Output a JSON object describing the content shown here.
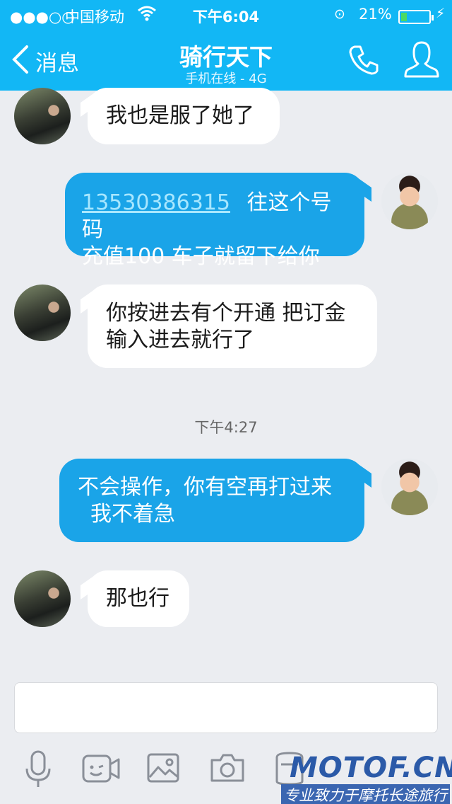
{
  "status_bar": {
    "signal": "●●●○○",
    "carrier": "中国移动",
    "time": "下午6:04",
    "battery_percent": "21%",
    "battery_level": 0.21
  },
  "nav": {
    "back_label": "消息",
    "title": "骑行天下",
    "subtitle": "手机在线 - 4G"
  },
  "messages": [
    {
      "direction": "in",
      "text": "我也是服了她了"
    },
    {
      "direction": "out",
      "phone_link": "13530386315",
      "line1_rest": "往这个号码",
      "line2": "充值100 车子就留下给你"
    },
    {
      "direction": "in",
      "line1": "你按进去有个开通 把订金",
      "line2": "输入进去就行了"
    },
    {
      "direction": "out",
      "line1": "不会操作，你有空再打过来",
      "line2": "我不着急"
    },
    {
      "direction": "in",
      "text": "那也行"
    }
  ],
  "timestamp": "下午4:27",
  "toolbar": [
    "microphone-icon",
    "video-icon",
    "image-icon",
    "camera-icon",
    "file-icon"
  ],
  "watermark": {
    "logo": "MOTOF.CN",
    "tagline": "专业致力于摩托长途旅行"
  },
  "colors": {
    "accent": "#12b7f5",
    "outgoing_bubble": "#1aa4e8",
    "background": "#ebedf1"
  }
}
